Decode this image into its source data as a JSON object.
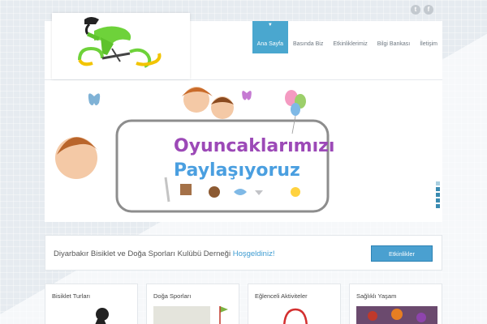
{
  "social": {
    "twitter_icon": "twitter-icon",
    "facebook_icon": "facebook-icon",
    "twitter_glyph": "t",
    "facebook_glyph": "f"
  },
  "nav": {
    "items": [
      {
        "label": "Ana Sayfa",
        "active": true
      },
      {
        "label": "Basında Biz"
      },
      {
        "label": "Etkinliklerimiz"
      },
      {
        "label": "Bilgi Bankası"
      },
      {
        "label": "İletişim"
      }
    ]
  },
  "slider": {
    "headline_line1": "Oyuncaklarımızı",
    "headline_line2": "Paylaşıyoruz"
  },
  "welcome": {
    "text": "Diyarbakır Bisiklet ve Doğa Sporları Kulübü Derneği ",
    "highlight": "Hoşgeldiniz!",
    "button_label": "Etkinlikler"
  },
  "cards": [
    {
      "title": "Bisiklet Turları"
    },
    {
      "title": "Doğa Sporları"
    },
    {
      "title": "Eğlenceli Aktiviteler"
    },
    {
      "title": "Sağlıklı Yaşam"
    }
  ],
  "colors": {
    "accent": "#4aa7cf",
    "button": "#4aa0d0",
    "highlight_text": "#3d9bd1"
  }
}
